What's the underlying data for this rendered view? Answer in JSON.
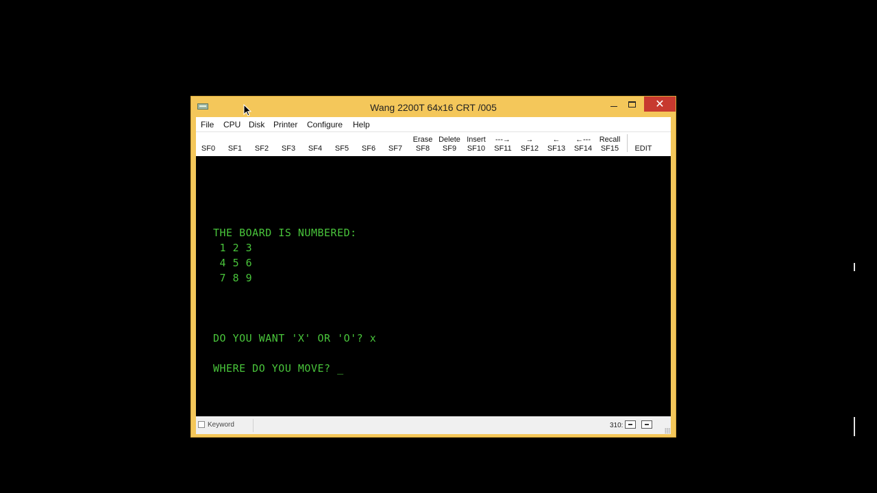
{
  "window": {
    "title": "Wang 2200T 64x16 CRT /005"
  },
  "menu": [
    {
      "label": "File"
    },
    {
      "label": "CPU"
    },
    {
      "label": "Disk"
    },
    {
      "label": "Printer"
    },
    {
      "label": "Configure"
    },
    {
      "label": "Help"
    }
  ],
  "toolbar": {
    "keys": [
      {
        "top": "",
        "bottom": "SF0"
      },
      {
        "top": "",
        "bottom": "SF1"
      },
      {
        "top": "",
        "bottom": "SF2"
      },
      {
        "top": "",
        "bottom": "SF3"
      },
      {
        "top": "",
        "bottom": "SF4"
      },
      {
        "top": "",
        "bottom": "SF5"
      },
      {
        "top": "",
        "bottom": "SF6"
      },
      {
        "top": "",
        "bottom": "SF7"
      },
      {
        "top": "Erase",
        "bottom": "SF8"
      },
      {
        "top": "Delete",
        "bottom": "SF9"
      },
      {
        "top": "Insert",
        "bottom": "SF10"
      },
      {
        "top": "---→",
        "bottom": "SF11"
      },
      {
        "top": "→",
        "bottom": "SF12"
      },
      {
        "top": "←",
        "bottom": "SF13"
      },
      {
        "top": "←---",
        "bottom": "SF14"
      },
      {
        "top": "Recall",
        "bottom": "SF15"
      }
    ],
    "edit_label": "EDIT"
  },
  "screen": {
    "lines": [
      "THE BOARD IS NUMBERED:",
      " 1 2 3",
      " 4 5 6",
      " 7 8 9",
      "DO YOU WANT 'X' OR 'O'? x",
      "WHERE DO YOU MOVE? _"
    ],
    "text_color": "#49c53b"
  },
  "status": {
    "keyword_label": "Keyword",
    "keyword_checked": false,
    "position": "310:"
  }
}
